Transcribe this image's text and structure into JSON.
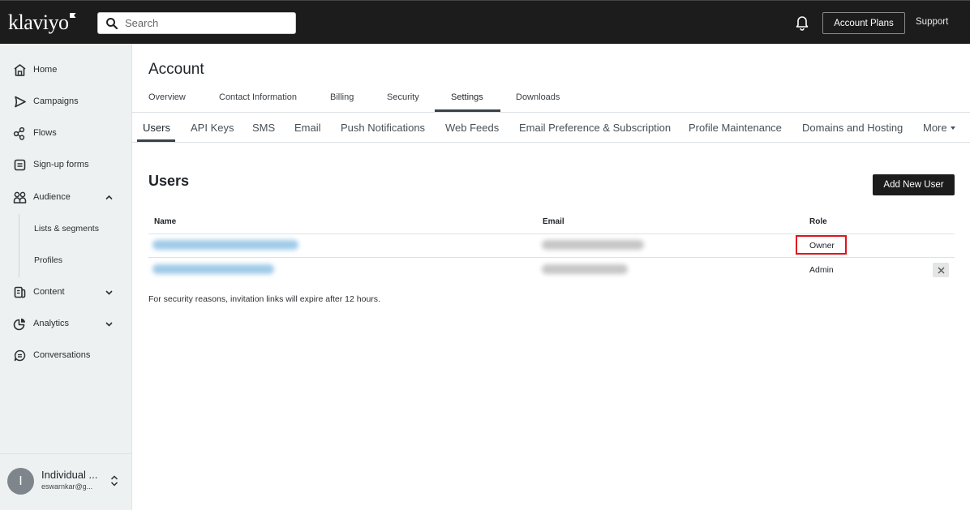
{
  "topbar": {
    "logo": "klaviyo",
    "search_placeholder": "Search",
    "account_plans_label": "Account Plans",
    "support_label": "Support",
    "icons": {
      "search": "search-icon",
      "notifications": "bell-icon"
    }
  },
  "sidebar": {
    "items": [
      {
        "label": "Home",
        "icon": "home-icon"
      },
      {
        "label": "Campaigns",
        "icon": "send-icon"
      },
      {
        "label": "Flows",
        "icon": "flows-icon"
      },
      {
        "label": "Sign-up forms",
        "icon": "form-icon"
      },
      {
        "label": "Audience",
        "icon": "people-icon",
        "expanded": true
      },
      {
        "label": "Content",
        "icon": "content-icon",
        "expanded": false
      },
      {
        "label": "Analytics",
        "icon": "analytics-icon",
        "expanded": false
      },
      {
        "label": "Conversations",
        "icon": "chat-icon"
      }
    ],
    "audience_subitems": [
      {
        "label": "Lists & segments"
      },
      {
        "label": "Profiles"
      }
    ],
    "account": {
      "avatar_letter": "I",
      "name": "Individual ...",
      "email": "eswarnkar@g..."
    }
  },
  "main": {
    "title": "Account",
    "primary_tabs": [
      {
        "label": "Overview"
      },
      {
        "label": "Contact Information"
      },
      {
        "label": "Billing"
      },
      {
        "label": "Security"
      },
      {
        "label": "Settings",
        "active": true
      },
      {
        "label": "Downloads"
      }
    ],
    "secondary_tabs": [
      {
        "label": "Users",
        "active": true
      },
      {
        "label": "API Keys"
      },
      {
        "label": "SMS"
      },
      {
        "label": "Email"
      },
      {
        "label": "Push Notifications"
      },
      {
        "label": "Web Feeds"
      },
      {
        "label": "Email Preference & Subscription"
      },
      {
        "label": "Profile Maintenance"
      },
      {
        "label": "Domains and Hosting"
      },
      {
        "label": "More"
      }
    ],
    "users": {
      "title": "Users",
      "add_button_label": "Add New User",
      "columns": {
        "name": "Name",
        "email": "Email",
        "role": "Role"
      },
      "rows": [
        {
          "name": "[redacted]",
          "email": "[redacted]",
          "role": "Owner",
          "highlighted": true,
          "removable": false
        },
        {
          "name": "[redacted]",
          "email": "[redacted]",
          "role": "Admin",
          "highlighted": false,
          "removable": true
        }
      ],
      "note": "For security reasons, invitation links will expire after 12 hours."
    },
    "highlight_color": "#e0141e"
  }
}
